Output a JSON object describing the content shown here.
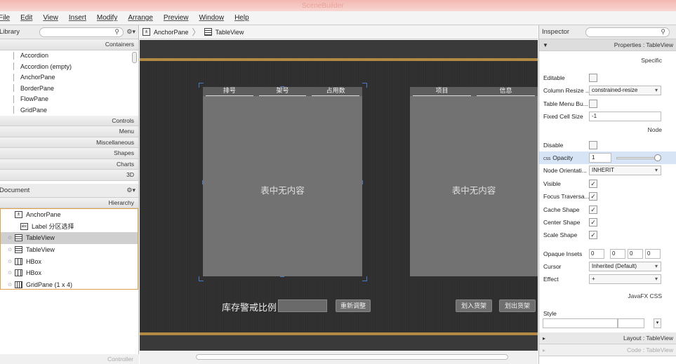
{
  "window": {
    "title": "SceneBuilder"
  },
  "menu": [
    "File",
    "Edit",
    "View",
    "Insert",
    "Modify",
    "Arrange",
    "Preview",
    "Window",
    "Help"
  ],
  "library": {
    "title": "Library",
    "sections": {
      "containers": "Containers",
      "rest": [
        "Controls",
        "Menu",
        "Miscellaneous",
        "Shapes",
        "Charts",
        "3D"
      ]
    },
    "items": [
      "Accordion",
      "Accordion  (empty)",
      "AnchorPane",
      "BorderPane",
      "FlowPane",
      "GridPane"
    ]
  },
  "document": {
    "title": "Document",
    "hierarchy_label": "Hierarchy",
    "items": [
      {
        "label": "AnchorPane",
        "icon": "anchor"
      },
      {
        "label": "Label  分区选择",
        "icon": "label"
      },
      {
        "label": "TableView",
        "icon": "table",
        "selected": true
      },
      {
        "label": "TableView",
        "icon": "table"
      },
      {
        "label": "HBox",
        "icon": "hbox"
      },
      {
        "label": "HBox",
        "icon": "hbox"
      },
      {
        "label": "GridPane (1 x 4)",
        "icon": "grid"
      }
    ],
    "footer": "Controller"
  },
  "breadcrumb": [
    "AnchorPane",
    "TableView"
  ],
  "canvas": {
    "table1": {
      "columns": [
        "排号",
        "架号",
        "占用数"
      ],
      "empty": "表中无内容"
    },
    "table2": {
      "columns": [
        "项目",
        "信息"
      ],
      "empty": "表中无内容"
    },
    "ratio_label": "库存警戒比例",
    "btn_adjust": "重新调整",
    "btn_in": "划入货架",
    "btn_out": "划出货架"
  },
  "inspector": {
    "title": "Inspector",
    "properties_header": "Properties : TableView",
    "specific": "Specific",
    "node": "Node",
    "javafx_css": "JavaFX CSS",
    "layout_header": "Layout : TableView",
    "code_header": "Code : TableView",
    "rows_specific": [
      {
        "label": "Editable",
        "kind": "check",
        "value": ""
      },
      {
        "label": "Column Resize ...",
        "kind": "combo",
        "value": "constrained-resize"
      },
      {
        "label": "Table Menu Bu...",
        "kind": "check",
        "value": ""
      },
      {
        "label": "Fixed Cell Size",
        "kind": "text",
        "value": "-1"
      }
    ],
    "rows_node": [
      {
        "label": "Disable",
        "kind": "check",
        "value": ""
      },
      {
        "label": "Opacity",
        "kind": "css",
        "value": "1"
      },
      {
        "label": "Node Orientati...",
        "kind": "combo",
        "value": "INHERIT"
      },
      {
        "label": "Visible",
        "kind": "check",
        "value": "✓"
      },
      {
        "label": "Focus Traversa...",
        "kind": "check",
        "value": "✓"
      },
      {
        "label": "Cache Shape",
        "kind": "check",
        "value": "✓"
      },
      {
        "label": "Center Shape",
        "kind": "check",
        "value": "✓"
      },
      {
        "label": "Scale Shape",
        "kind": "check",
        "value": "✓"
      }
    ],
    "opaque_insets": {
      "label": "Opaque Insets",
      "values": [
        "0",
        "0",
        "0",
        "0"
      ]
    },
    "cursor": {
      "label": "Cursor",
      "value": "Inherited (Default)"
    },
    "effect": {
      "label": "Effect",
      "value": "+"
    },
    "style_label": "Style",
    "css_badge": "CSS"
  }
}
